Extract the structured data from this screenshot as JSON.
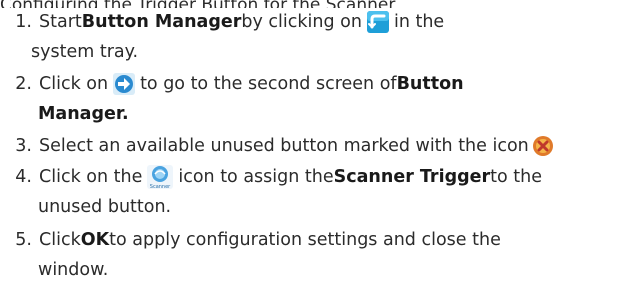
{
  "header_fragment": "Configuring the Trigger Button for the Scanner",
  "steps": [
    {
      "number": "1.",
      "part1": "Start ",
      "bold1": "Button Manager",
      "part2": " by clicking on ",
      "icon": "button-manager-tray-icon",
      "part3": " in the",
      "cont": "system tray."
    },
    {
      "number": "2.",
      "part1": "Click on ",
      "icon": "arrow-right-icon",
      "part2": " to go to the second screen of ",
      "bold1": "Button",
      "cont_bold": "Manager."
    },
    {
      "number": "3.",
      "part1": "Select an available unused button marked with the icon",
      "icon": "unused-button-icon"
    },
    {
      "number": "4.",
      "part1": "Click on the ",
      "icon": "scanner-icon",
      "icon_label": "Scanner",
      "part2": " icon to assign the ",
      "bold1": "Scanner Trigger",
      "part3": " to the",
      "cont": "unused button."
    },
    {
      "number": "5.",
      "part1": "Click ",
      "bold1": "OK",
      "part2": " to apply configuration settings and close the",
      "cont": "window."
    }
  ],
  "colors": {
    "text": "#2b2b2b",
    "tray_icon_bg": "#1e9fd8",
    "arrow_icon_bg": "#2a8ad0",
    "unused_icon": "#e07a2a",
    "scanner_icon": "#4aa3e0"
  }
}
